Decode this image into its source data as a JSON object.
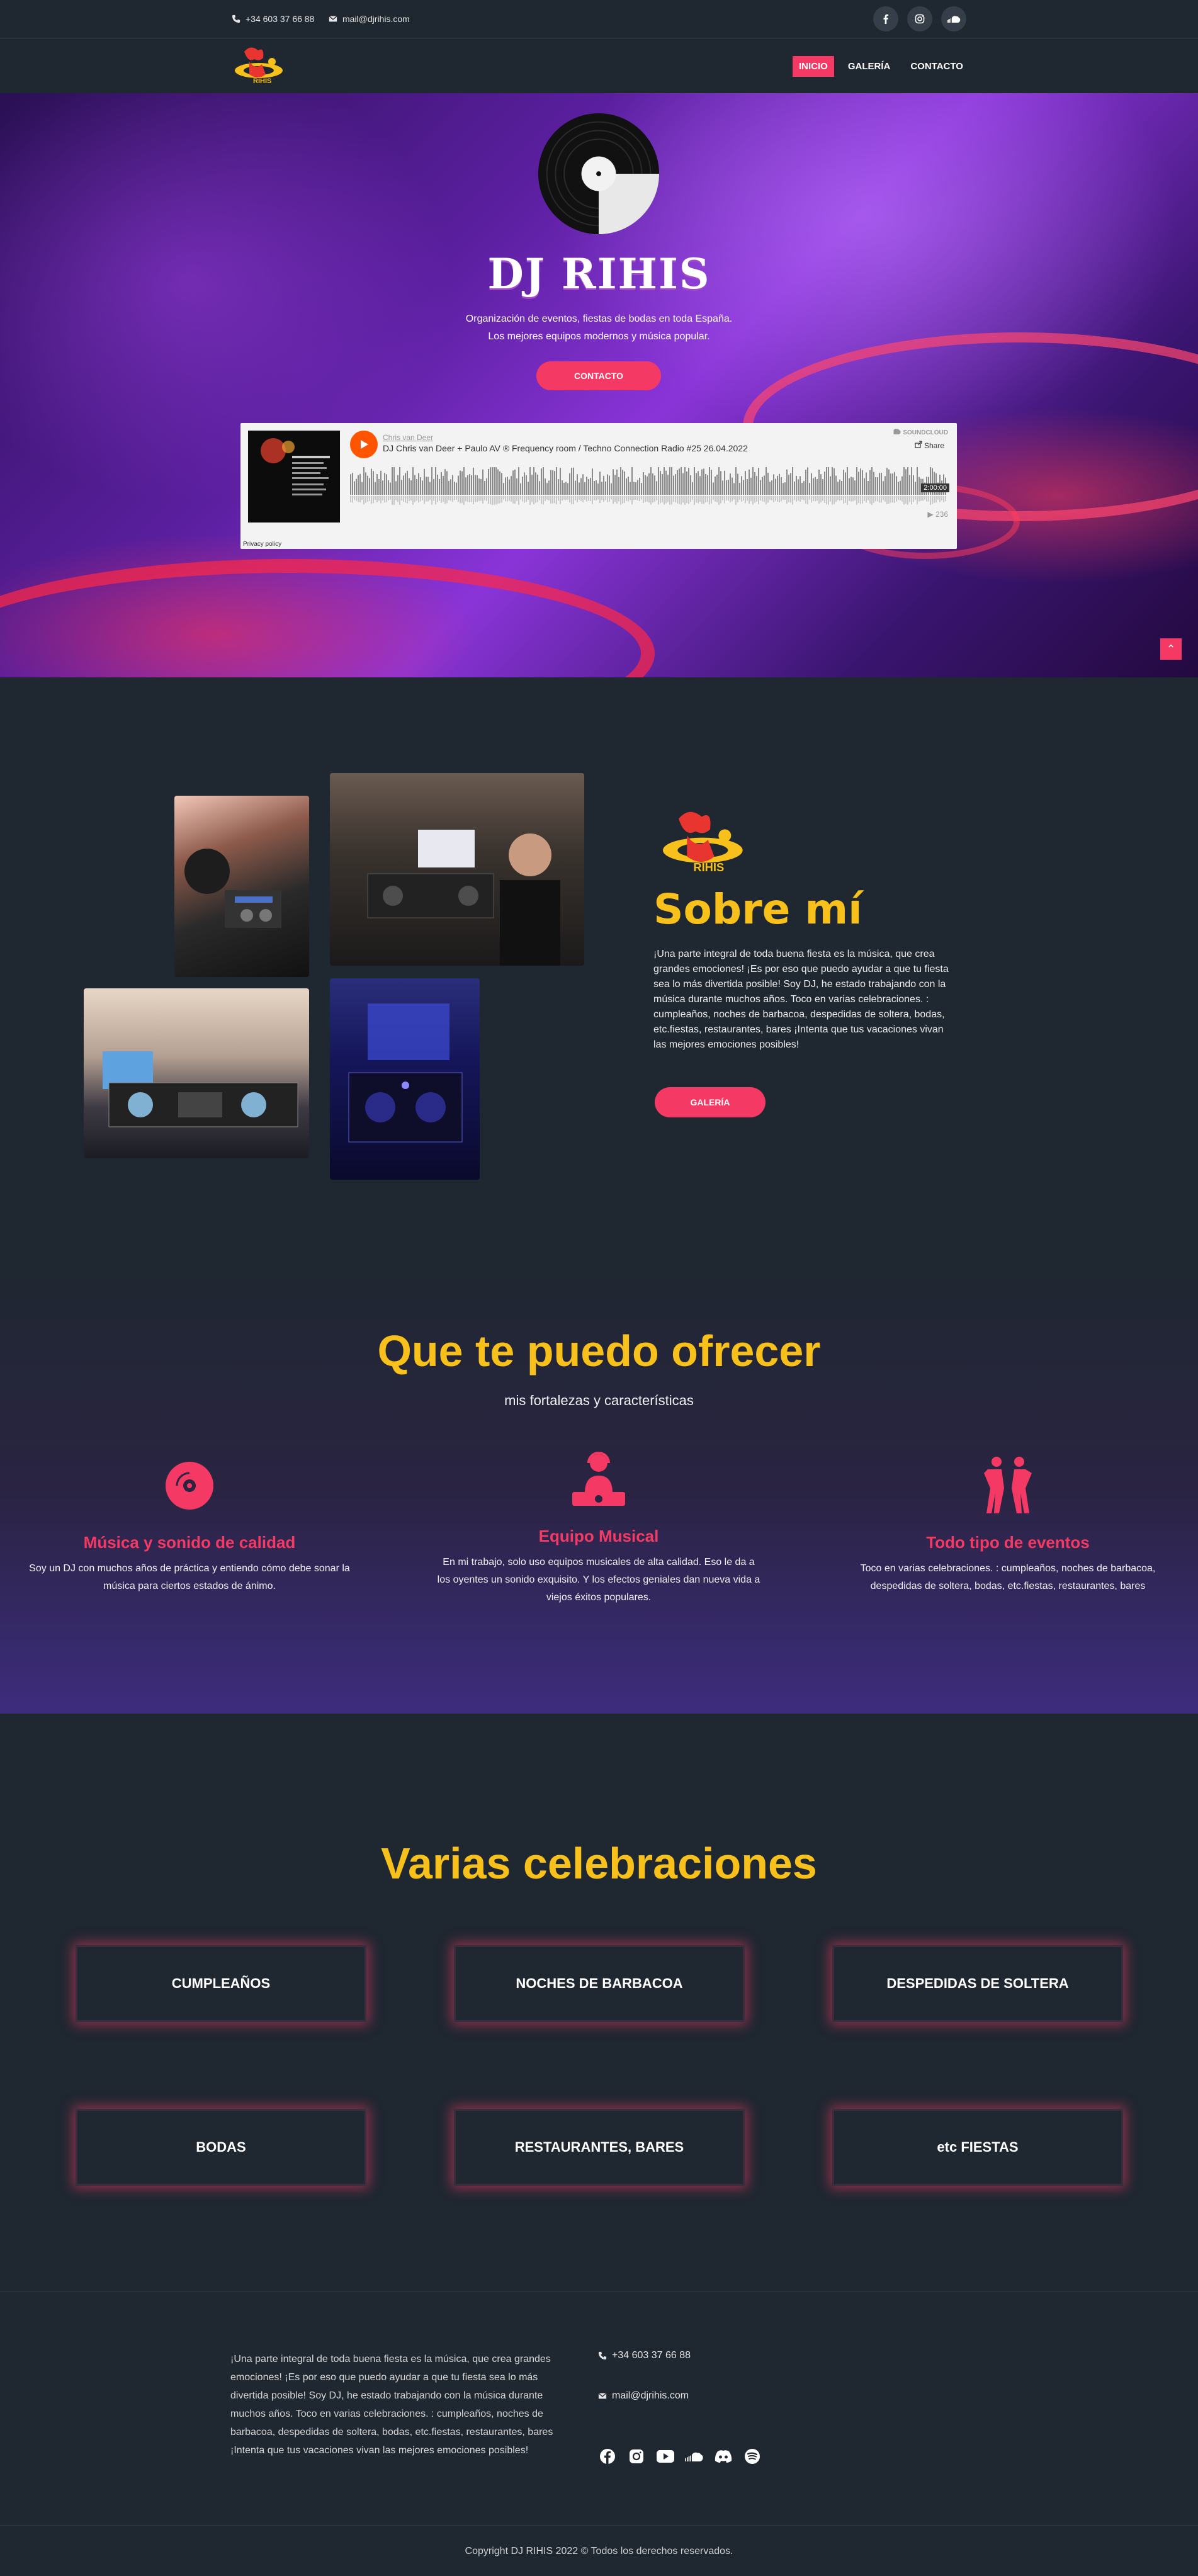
{
  "topbar": {
    "phone": "+34 603 37 66 88",
    "email": "mail@djrihis.com",
    "social": [
      "facebook-icon",
      "instagram-icon",
      "soundcloud-icon"
    ]
  },
  "nav": {
    "items": [
      "INICIO",
      "GALERÍA",
      "CONTACTO"
    ],
    "active": "INICIO"
  },
  "hero": {
    "title": "DJ RIHIS",
    "line1": "Organización de eventos, fiestas de bodas en toda España.",
    "line2": "Los mejores equipos modernos y música popular.",
    "button": "CONTACTO"
  },
  "soundcloud": {
    "user": "Chris van Deer",
    "track": "DJ Chris van Deer + Paulo AV ® Frequency room / Techno Connection Radio #25 26.04.2022",
    "brand": "SOUNDCLOUD",
    "share": "Share",
    "duration": "2:00:00",
    "plays": "236",
    "privacy": "Privacy policy"
  },
  "about": {
    "title": "Sobre mí",
    "text": "¡Una parte integral de toda buena fiesta es la música, que crea grandes emociones! ¡Es por eso que puedo ayudar a que tu fiesta sea lo más divertida posible! Soy DJ, he estado trabajando con la música durante muchos años. Toco en varias celebraciones. : cumpleaños, noches de barbacoa, despedidas de soltera, bodas, etc.fiestas, restaurantes, bares ¡Intenta que tus vacaciones vivan las mejores emociones posibles!",
    "button": "GALERÍA"
  },
  "services": {
    "title": "Que te puedo ofrecer",
    "subtitle": "mis fortalezas y características",
    "items": [
      {
        "icon": "vinyl-disc-icon",
        "title": "Música y sonido de calidad",
        "text": "Soy un DJ con muchos años de práctica y entiendo cómo debe sonar la música para ciertos estados de ánimo."
      },
      {
        "icon": "dj-headphones-icon",
        "title": "Equipo Musical",
        "text": "En mi trabajo, solo uso equipos musicales de alta calidad. Eso le da a los oyentes un sonido exquisito. Y los efectos geniales dan nueva vida a viejos éxitos populares."
      },
      {
        "icon": "dancing-people-icon",
        "title": "Todo tipo de eventos",
        "text": "Toco en varias celebraciones. : cumpleaños, noches de barbacoa, despedidas de soltera, bodas, etc.fiestas, restaurantes, bares"
      }
    ]
  },
  "celebrations": {
    "title": "Varias celebraciones",
    "items": [
      "CUMPLEAÑOS",
      "NOCHES DE BARBACOA",
      "DESPEDIDAS DE SOLTERA",
      "BODAS",
      "RESTAURANTES, BARES",
      "etc FIESTAS"
    ]
  },
  "footer": {
    "text": "¡Una parte integral de toda buena fiesta es la música, que crea grandes emociones! ¡Es por eso que puedo ayudar a que tu fiesta sea lo más divertida posible! Soy DJ, he estado trabajando con la música durante muchos años. Toco en varias celebraciones. : cumpleaños, noches de barbacoa, despedidas de soltera, bodas, etc.fiestas, restaurantes, bares ¡Intenta que tus vacaciones vivan las mejores emociones posibles!",
    "phone": "+34 603 37 66 88",
    "email": "mail@djrihis.com",
    "social": [
      "facebook-icon",
      "instagram-icon",
      "youtube-icon",
      "soundcloud-icon",
      "discord-icon",
      "spotify-icon"
    ],
    "copyright": "Copyright DJ RIHIS 2022 © Todos los derechos reservados."
  },
  "colors": {
    "accent": "#f43a64",
    "gold": "#f8c01b",
    "background": "#1f2731"
  }
}
